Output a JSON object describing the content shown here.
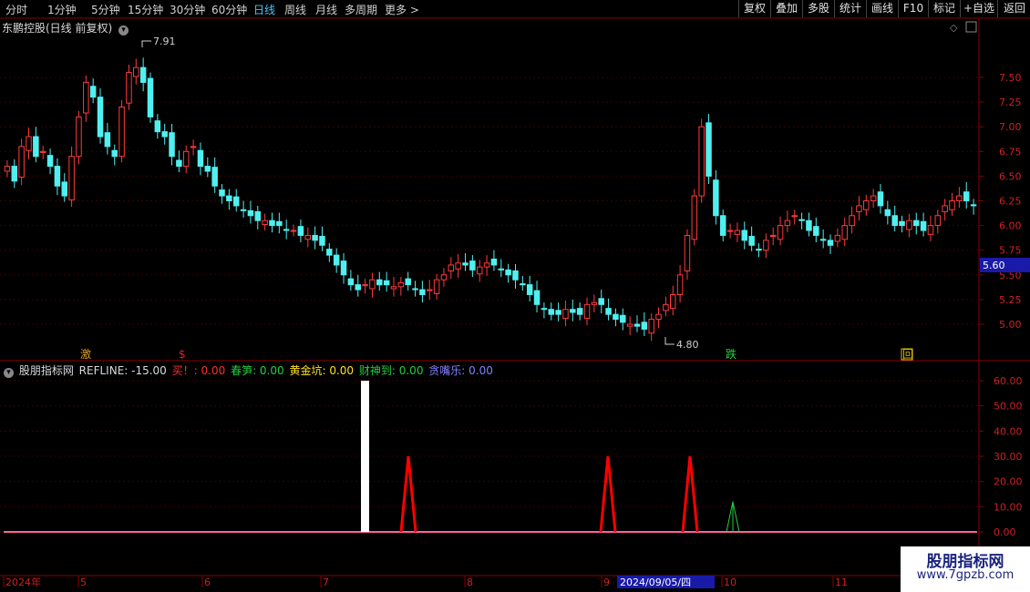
{
  "toolbar": {
    "tabs": [
      "分时",
      "1分钟",
      "5分钟",
      "15分钟",
      "30分钟",
      "60分钟",
      "日线",
      "周线",
      "月线",
      "多周期",
      "更多 >"
    ],
    "active_tab": "日线",
    "right_buttons": [
      "复权",
      "叠加",
      "多股",
      "统计",
      "画线",
      "F10",
      "标记",
      "+自选",
      "返回"
    ]
  },
  "chart_title": "东鹏控股(日线 前复权)",
  "price_axis": {
    "ticks": [
      "7.50",
      "7.25",
      "7.00",
      "6.75",
      "6.50",
      "6.25",
      "6.00",
      "5.75",
      "5.50",
      "5.25",
      "5.00"
    ],
    "current_price_tag": "5.60",
    "current_price_color": "#1a1aa8"
  },
  "annotations": {
    "high_label": "7.91",
    "low_label": "4.80"
  },
  "signal_markers": [
    {
      "label": "激",
      "color": "#e0a020"
    },
    {
      "label": "$",
      "color": "#e02020"
    },
    {
      "label": "跌",
      "color": "#20d040"
    },
    {
      "label": "回",
      "color": "#e0c000"
    }
  ],
  "indicator": {
    "name": "股朋指标网",
    "refline_label": "REFLINE: -15.00",
    "items": [
      {
        "label": "买！: 0.00",
        "color": "#ff3030"
      },
      {
        "label": "春笋: 0.00",
        "color": "#20d040"
      },
      {
        "label": "黄金坑: 0.00",
        "color": "#ffe020"
      },
      {
        "label": "财神到: 0.00",
        "color": "#20d040"
      },
      {
        "label": "贪嘴乐: 0.00",
        "color": "#8080ff"
      }
    ],
    "axis_ticks": [
      "60.00",
      "50.00",
      "40.00",
      "30.00",
      "20.00",
      "10.00",
      "0.00"
    ]
  },
  "chart_data": {
    "type": "candlestick",
    "title": "东鹏控股(日线 前复权)",
    "ylim": [
      4.7,
      8.0
    ],
    "high": 7.91,
    "low": 4.8,
    "last": 5.6,
    "indicator_series": [
      {
        "name": "买！",
        "color": "#ff0000",
        "spikes": [
          30,
          30,
          30
        ]
      },
      {
        "name": "春笋",
        "color": "#20d040",
        "spikes": [
          12
        ]
      },
      {
        "name": "bar",
        "color": "#ffffff",
        "spikes": [
          60
        ]
      }
    ],
    "indicator_ylim": [
      0,
      60
    ]
  },
  "time_axis": {
    "labels": [
      "2024年",
      "5",
      "6",
      "7",
      "8",
      "9",
      "10",
      "11"
    ],
    "cursor_date": "2024/09/05/四"
  },
  "watermark": {
    "line1": "股朋指标网",
    "line2": "www.7gpzb.com"
  }
}
